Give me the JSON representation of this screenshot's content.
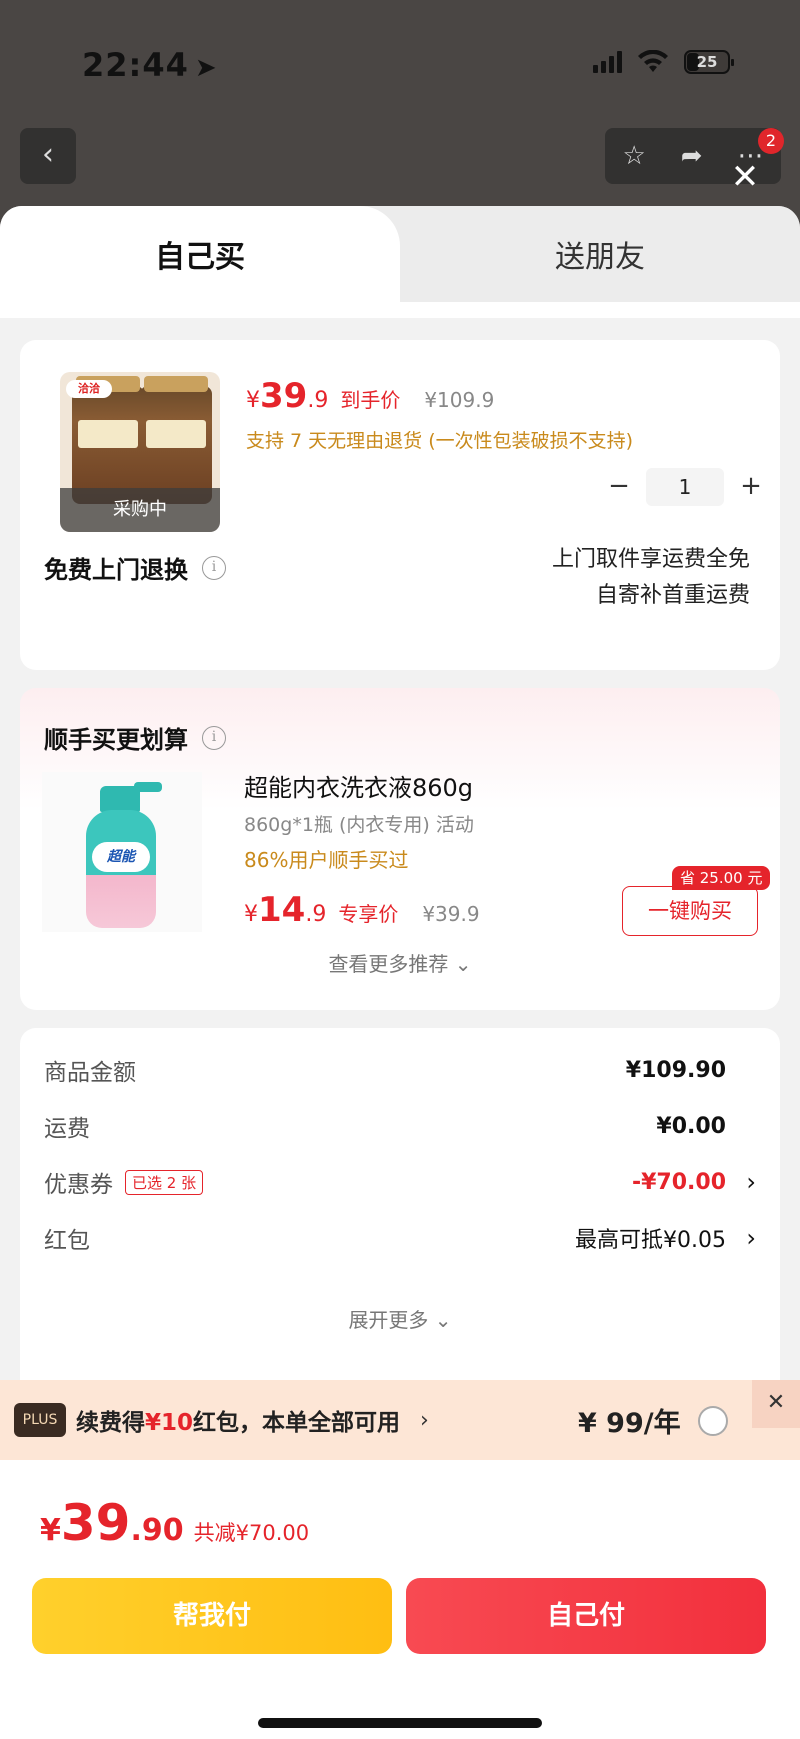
{
  "status_bar": {
    "time": "22:44",
    "battery": "25"
  },
  "nav": {
    "badge_count": "2"
  },
  "tabs": [
    {
      "label": "自己买",
      "active": true
    },
    {
      "label": "送朋友",
      "active": false
    }
  ],
  "product": {
    "image_tag": "采购中",
    "brand_logo": "洽洽",
    "price_yen": "¥",
    "price_int": "39",
    "price_dec": ".9",
    "price_label": "到手价",
    "original_price": "¥109.9",
    "return_policy": "支持 7 天无理由退货 (一次性包装破损不支持)",
    "quantity": "1",
    "minus": "−",
    "plus": "+"
  },
  "free_return": {
    "title": "免费上门退换",
    "line1": "上门取件享运费全免",
    "line2": "自寄补首重运费"
  },
  "recommend": {
    "title": "顺手买更划算",
    "item_name": "超能内衣洗衣液860g",
    "item_logo": "超能",
    "spec": "860g*1瓶 (内衣专用) 活动",
    "social_proof": "86%用户顺手买过",
    "price_yen": "¥",
    "price_int": "14",
    "price_dec": ".9",
    "price_label": "专享价",
    "original_price": "¥39.9",
    "save_badge": "省 25.00 元",
    "buy_button": "一键购买",
    "more": "查看更多推荐 ⌄"
  },
  "summary": {
    "rows": [
      {
        "label": "商品金额",
        "value": "¥109.90"
      },
      {
        "label": "运费",
        "value": "¥0.00"
      },
      {
        "label": "优惠券",
        "badge": "已选 2 张",
        "value": "-¥70.00"
      },
      {
        "label": "红包",
        "value": "最高可抵¥0.05"
      }
    ],
    "more": "展开更多 ⌄"
  },
  "plus_bar": {
    "badge": "PLUS",
    "text_prefix": "续费得",
    "text_highlight": "¥10",
    "text_suffix": "红包，本单全部可用",
    "arrow": "›",
    "price": "¥ 99/年"
  },
  "pay": {
    "yen": "¥",
    "total_int": "39",
    "total_dec": ".90",
    "saved": "共减¥70.00",
    "help_pay": "帮我付",
    "self_pay": "自己付"
  },
  "colors": {
    "accent_red": "#e5242b",
    "gold": "#c98a1c",
    "help_yellow": "#ffc71c"
  }
}
